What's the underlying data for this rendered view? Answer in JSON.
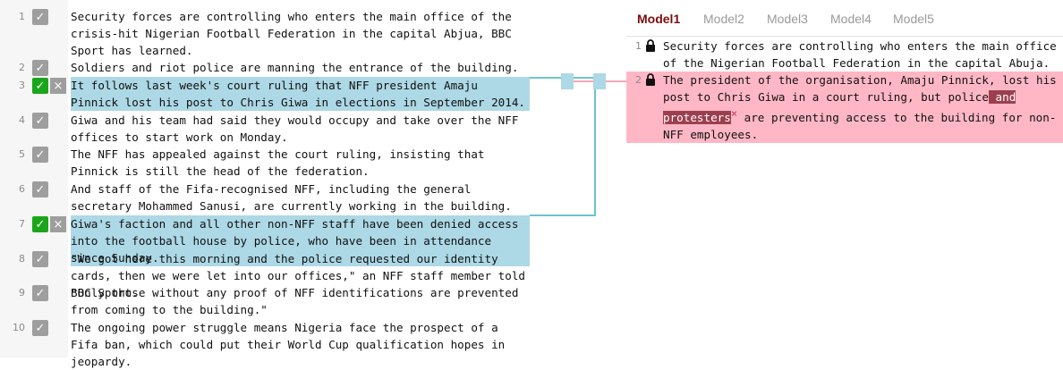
{
  "left": {
    "lines": [
      {
        "num": "1",
        "text": "Security forces are controlling who enters the main office of the crisis-hit Nigerian Football Federation in the capital Abjua, BBC Sport has learned.",
        "checked": false,
        "highlight": false
      },
      {
        "num": "2",
        "text": "Soldiers and riot police are manning the entrance of the building.",
        "checked": false,
        "highlight": false
      },
      {
        "num": "3",
        "text": "It follows last week's court ruling that NFF president Amaju Pinnick lost his post to Chris Giwa in elections in September 2014.",
        "checked": true,
        "highlight": true
      },
      {
        "num": "4",
        "text": "Giwa and his team had said they would occupy and take over the NFF offices to start work on Monday.",
        "checked": false,
        "highlight": false
      },
      {
        "num": "5",
        "text": "The NFF has appealed against the court ruling, insisting that Pinnick is still the head of the federation.",
        "checked": false,
        "highlight": false
      },
      {
        "num": "6",
        "text": "And staff of the Fifa-recognised NFF, including the general secretary Mohammed Sanusi, are currently working in the building.",
        "checked": false,
        "highlight": false
      },
      {
        "num": "7",
        "text": "Giwa's faction and all other non-NFF staff have been denied access into the football house by police, who have been in attendance since Sunday.",
        "checked": true,
        "highlight": true
      },
      {
        "num": "8",
        "text": "\"We got here this morning and the police requested our identity cards, then we were let into our offices,\" an NFF staff member told BBC Sport.",
        "checked": false,
        "highlight": false
      },
      {
        "num": "9",
        "text": "\"Only those without any proof of NFF identifications are prevented from coming to the building.\"",
        "checked": false,
        "highlight": false
      },
      {
        "num": "10",
        "text": "The ongoing power struggle means Nigeria face the prospect of a Fifa ban, which could put their World Cup qualification hopes in jeopardy.",
        "checked": false,
        "highlight": false
      }
    ],
    "check_glyph": "✓",
    "remove_glyph": "×"
  },
  "tabs": [
    "Model1",
    "Model2",
    "Model3",
    "Model4",
    "Model5"
  ],
  "active_tab": "Model1",
  "right": {
    "lines": [
      {
        "num": "1",
        "text": "Security forces are controlling who enters the main office of the Nigerian Football Federation in the capital Abuja."
      },
      {
        "num": "2",
        "text_before": "The president of the organisation, Amaju Pinnick, lost his post to Chris Giwa in a court ruling, but police",
        "marked_1": " and ",
        "marked_2": "protesters",
        "remove_glyph": "×",
        "text_after": "  are preventing access to the building for non-NFF employees."
      }
    ]
  },
  "colors": {
    "highlight_blue": "#add8e6",
    "highlight_pink": "#ffb7c5",
    "marked": "#9b3f4f",
    "check_on": "#1aa61a",
    "check_off": "#9e9e9e",
    "active_tab": "#7a0e0e"
  }
}
